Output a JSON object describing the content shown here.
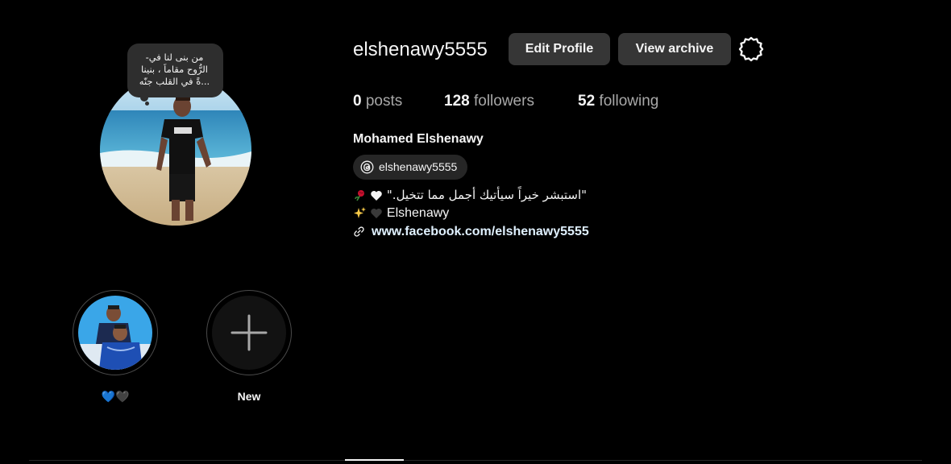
{
  "profile": {
    "username": "elshenawy5555",
    "full_name": "Mohamed Elshenawy",
    "threads_handle": "elshenawy5555",
    "note_lines": [
      "من بنى لنا في-",
      "الرُّوح مقاماً ، بنينا",
      "...ةً في القلب جنّه"
    ]
  },
  "buttons": {
    "edit_profile": "Edit Profile",
    "view_archive": "View archive"
  },
  "stats": {
    "posts_count": "0",
    "posts_label": "posts",
    "followers_count": "128",
    "followers_label": "followers",
    "following_count": "52",
    "following_label": "following"
  },
  "bio": {
    "line1": "\"استبشر خيراً سيأتيك أجمل مما تتخيل.\"",
    "line2": "Elshenawy",
    "link": "www.facebook.com/elshenawy5555"
  },
  "highlights": [
    {
      "label": "💙🖤",
      "icon": "highlight-photo"
    },
    {
      "label": "New",
      "icon": "plus-icon"
    }
  ],
  "icons": {
    "settings": "gear-icon",
    "threads": "threads-icon",
    "link": "link-icon"
  },
  "colors": {
    "background": "#000000",
    "button": "#363636",
    "text_primary": "#f5f5f5",
    "text_secondary": "#a8a8a8",
    "link": "#e0f1ff"
  }
}
